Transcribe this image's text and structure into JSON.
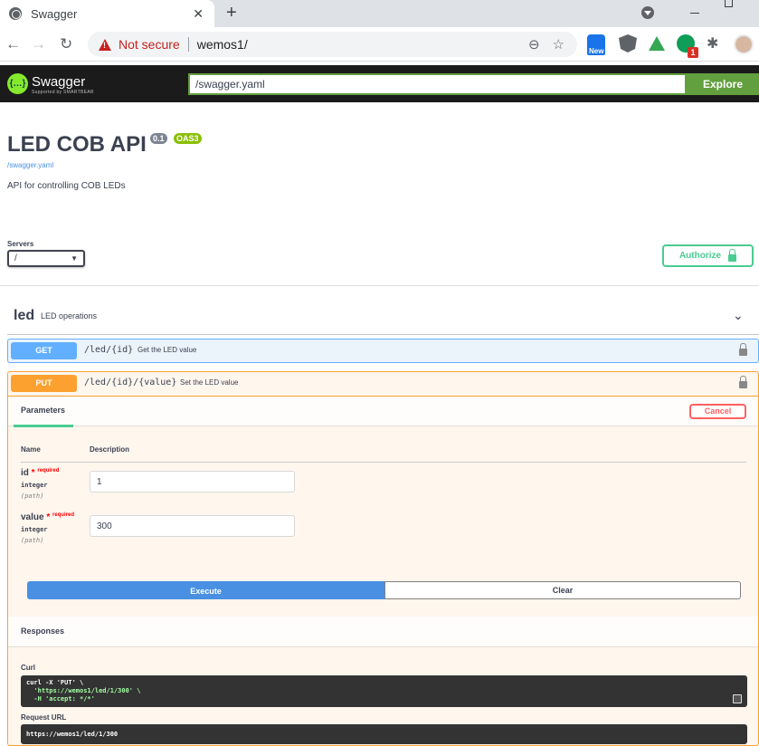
{
  "browser": {
    "tab_title": "Swagger",
    "not_secure": "Not secure",
    "url": "wemos1/",
    "ext_new_label": "New",
    "ext_badge": "1"
  },
  "swagger_bar": {
    "brand": "Swagger",
    "sub": "Supported by SMARTBEAR",
    "spec_url": "/swagger.yaml",
    "explore_label": "Explore"
  },
  "info": {
    "title": "LED COB API",
    "version": "0.1",
    "oas": "OAS3",
    "spec_link": "/swagger.yaml",
    "description": "API for controlling COB LEDs"
  },
  "servers": {
    "label": "Servers",
    "selected": "/"
  },
  "authorize_label": "Authorize",
  "tag": {
    "name": "led",
    "description": "LED operations"
  },
  "operations": [
    {
      "method": "GET",
      "path": "/led/{id}",
      "summary": "Get the LED value"
    },
    {
      "method": "PUT",
      "path": "/led/{id}/{value}",
      "summary": "Set the LED value"
    }
  ],
  "put_panel": {
    "parameters_tab": "Parameters",
    "cancel_label": "Cancel",
    "col_name": "Name",
    "col_description": "Description",
    "required_text": "required",
    "params": [
      {
        "name": "id",
        "type": "integer",
        "in": "(path)",
        "value": "1"
      },
      {
        "name": "value",
        "type": "integer",
        "in": "(path)",
        "value": "300"
      }
    ],
    "execute_label": "Execute",
    "clear_label": "Clear",
    "responses_label": "Responses",
    "curl_label": "Curl",
    "curl_line1": "curl -X 'PUT' \\",
    "curl_line2": "  'https://wemos1/led/1/300' \\",
    "curl_line3": "  -H 'accept: */*'",
    "request_url_label": "Request URL",
    "request_url": "https://wemos1/led/1/300"
  }
}
